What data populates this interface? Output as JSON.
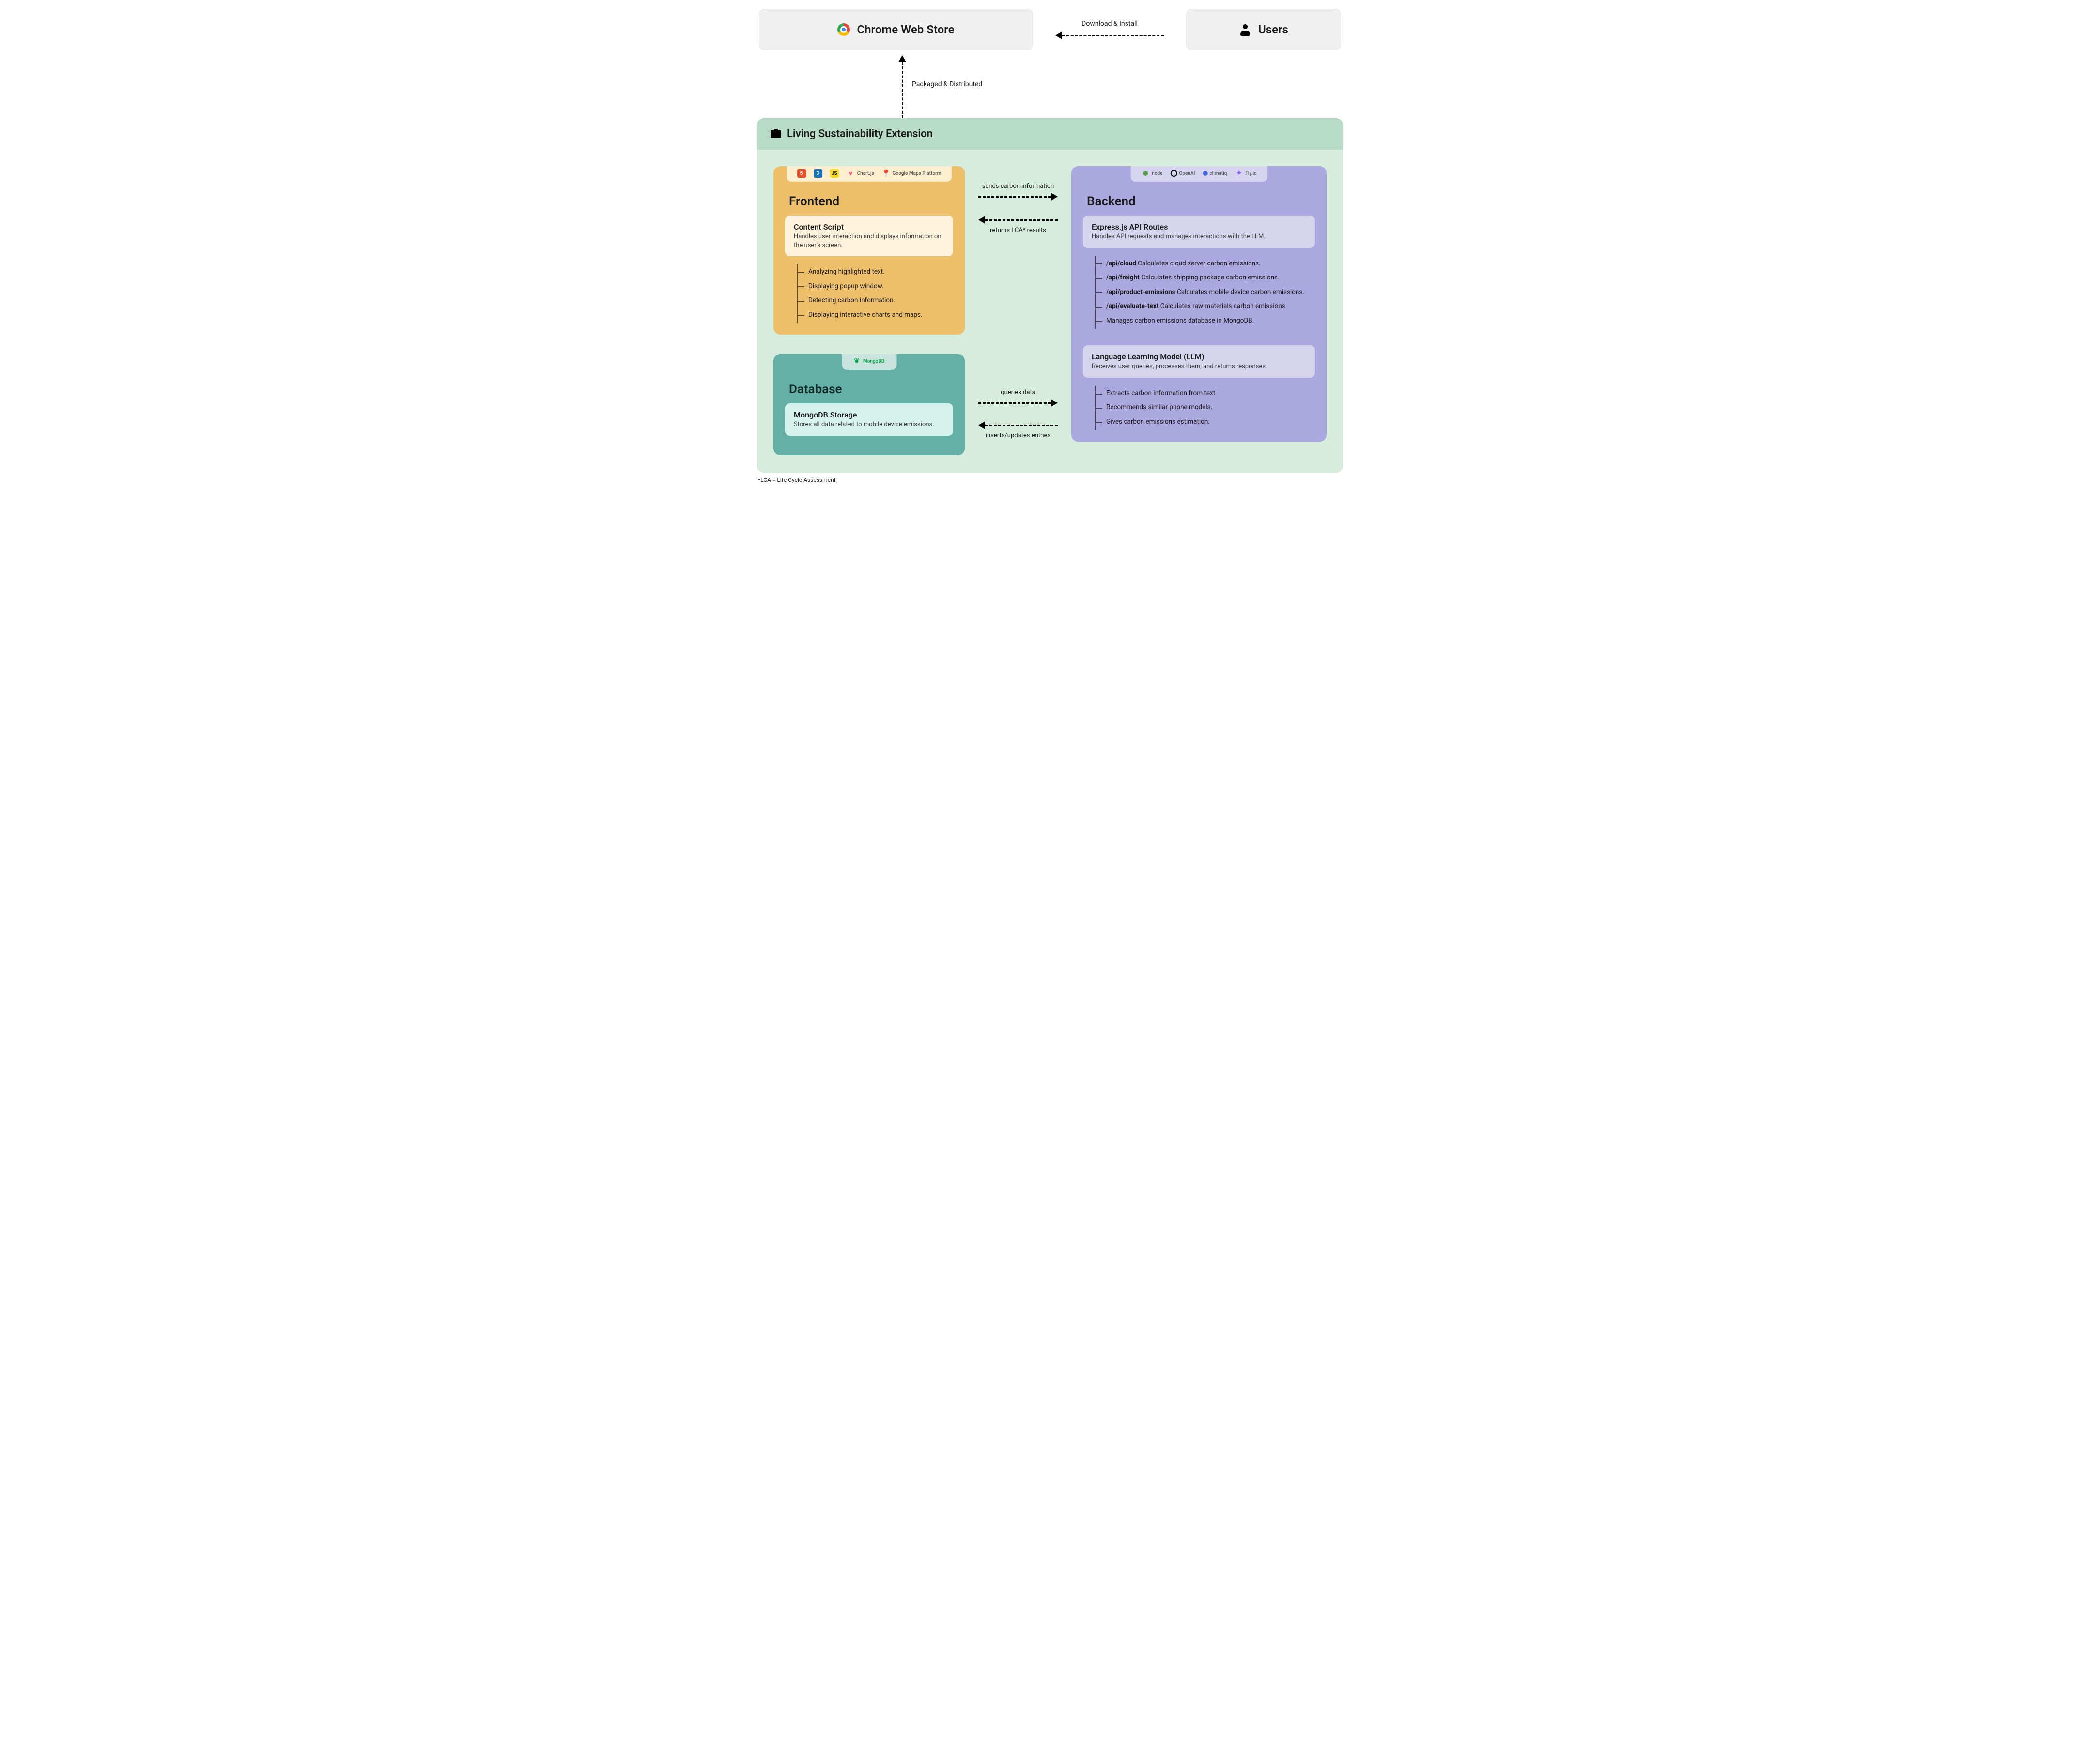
{
  "top": {
    "chrome_label": "Chrome Web Store",
    "users_label": "Users",
    "download_label": "Download & Install",
    "packaged_label": "Packaged & Distributed"
  },
  "extension": {
    "title": "Living Sustainability Extension"
  },
  "frontend": {
    "title": "Frontend",
    "tech": [
      "HTML",
      "CSS",
      "JS",
      "Chart.js",
      "Google Maps Platform"
    ],
    "card": {
      "title": "Content Script",
      "desc": "Handles user interaction and displays information on the user's screen."
    },
    "items": [
      "Analyzing highlighted text.",
      "Displaying popup window.",
      "Detecting carbon information.",
      "Displaying interactive charts and maps."
    ]
  },
  "backend": {
    "title": "Backend",
    "tech": [
      "node",
      "OpenAI",
      "climatiq",
      "Fly.io"
    ],
    "card1": {
      "title": "Express.js API Routes",
      "desc": "Handles API requests and manages interactions with the LLM."
    },
    "routes": [
      {
        "path": "/api/cloud",
        "desc": "Calculates cloud server carbon emissions."
      },
      {
        "path": "/api/freight",
        "desc": "Calculates shipping package carbon emissions."
      },
      {
        "path": "/api/product-emissions",
        "desc": "Calculates mobile device carbon emissions."
      },
      {
        "path": "/api/evaluate-text",
        "desc": "Calculates raw materials carbon emissions."
      },
      {
        "path": "",
        "desc": "Manages carbon emissions database in MongoDB."
      }
    ],
    "card2": {
      "title": "Language Learning Model (LLM)",
      "desc": "Receives user queries, processes them, and returns responses."
    },
    "llm_items": [
      "Extracts carbon information from text.",
      "Recommends similar phone models.",
      "Gives carbon emissions estimation."
    ]
  },
  "database": {
    "title": "Database",
    "tech": [
      "MongoDB."
    ],
    "card": {
      "title": "MongoDB Storage",
      "desc": "Stores all data related to mobile device emissions."
    }
  },
  "arrows": {
    "fe_to_be": "sends carbon information",
    "be_to_fe": "returns LCA* results",
    "db_to_be": "queries data",
    "be_to_db": "inserts/updates entries"
  },
  "footnote": "*LCA = Life Cycle Assessment"
}
